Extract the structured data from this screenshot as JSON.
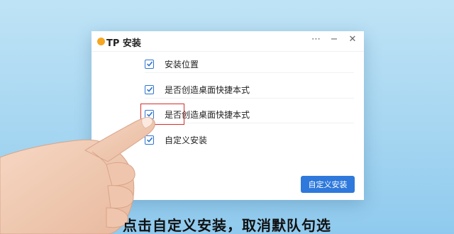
{
  "window": {
    "title": "TP 安装",
    "controls": {
      "more": "⋯",
      "minimize": "−",
      "close": "✕"
    }
  },
  "options": [
    {
      "label": "安装位置",
      "checked": true
    },
    {
      "label": "是否创造桌面快捷本式",
      "checked": true
    },
    {
      "label": "是否创造桌面快捷本式",
      "checked": true
    },
    {
      "label": "自定义安装",
      "checked": true
    }
  ],
  "buttons": {
    "custom_install": "自定义安装"
  },
  "caption": "点击自定义安装，取消默队句选",
  "colors": {
    "accent": "#2e79db",
    "highlight": "#d0312d",
    "app_dot": "#f5a623"
  }
}
